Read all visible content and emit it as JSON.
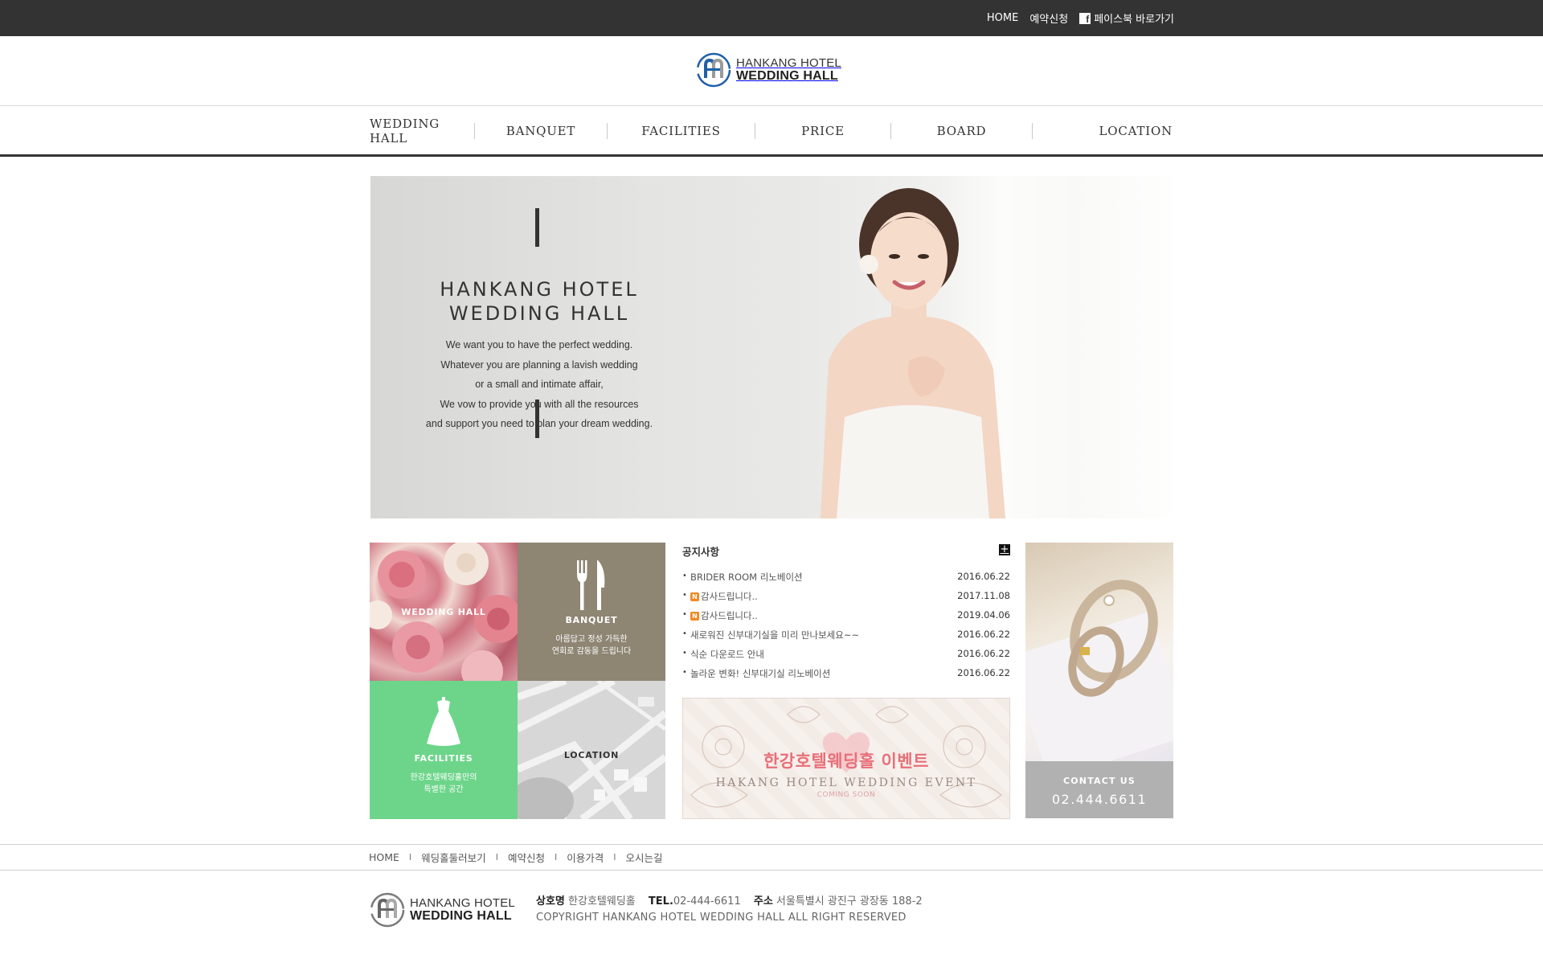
{
  "topbar": {
    "home": "HOME",
    "reservation": "예약신청",
    "facebook": "페이스북 바로가기",
    "facebook_icon": "facebook-icon"
  },
  "brand": {
    "line1": "HANKANG HOTEL",
    "line2": "WEDDING HALL",
    "colors": {
      "blue": "#1f5fa8",
      "gray": "#8a8a8a"
    }
  },
  "nav": [
    {
      "label": "WEDDING HALL"
    },
    {
      "label": "BANQUET"
    },
    {
      "label": "FACILITIES"
    },
    {
      "label": "PRICE"
    },
    {
      "label": "BOARD"
    },
    {
      "label": "LOCATION"
    }
  ],
  "hero": {
    "title_line1": "HANKANG HOTEL",
    "title_line2": "WEDDING HALL",
    "desc": [
      "We want you to have the perfect wedding.",
      "Whatever you are planning a lavish wedding",
      "or a small and intimate affair,",
      "We vow to provide you with all the resources",
      "and support you need to plan your dream wedding."
    ]
  },
  "tiles": {
    "wedding": {
      "label": "WEDDING HALL"
    },
    "banquet": {
      "label": "BANQUET",
      "sub1": "아름답고 정성 가득한",
      "sub2": "연회로 감동을 드립니다"
    },
    "facilities": {
      "label": "FACILITIES",
      "sub1": "한강호텔웨딩홀만의",
      "sub2": "특별한 공간"
    },
    "location": {
      "label": "LOCATION"
    }
  },
  "notice": {
    "title": "공지사항",
    "more_icon": "plus-icon",
    "items": [
      {
        "subject": "BRIDER ROOM 리노베이션",
        "date": "2016.06.22",
        "new": false
      },
      {
        "subject": "감사드립니다..",
        "date": "2017.11.08",
        "new": true
      },
      {
        "subject": "감사드립니다..",
        "date": "2019.04.06",
        "new": true
      },
      {
        "subject": "새로워진 신부대기실을 미리 만나보세요~~",
        "date": "2016.06.22",
        "new": false
      },
      {
        "subject": "식순 다운로드 안내",
        "date": "2016.06.22",
        "new": false
      },
      {
        "subject": "놀라운 변화! 신부대기실 리노베이션",
        "date": "2016.06.22",
        "new": false
      }
    ]
  },
  "event": {
    "title_kr": "한강호텔웨딩홀 이벤트",
    "title_en": "HAKANG HOTEL WEDDING EVENT",
    "soon": "COMING SOON"
  },
  "contact": {
    "label": "CONTACT US",
    "phone": "02.444.6611"
  },
  "footer_nav": [
    "HOME",
    "웨딩홀둘러보기",
    "예약신청",
    "이용가격",
    "오시는길"
  ],
  "footer": {
    "company_label": "상호명",
    "company": "한강호텔웨딩홀",
    "tel_label": "TEL.",
    "tel": "02-444-6611",
    "addr_label": "주소",
    "addr": "서울특별시 광진구 광장동 188-2",
    "copyright": "COPYRIGHT HANKANG HOTEL WEDDING HALL ALL RIGHT RESERVED"
  }
}
